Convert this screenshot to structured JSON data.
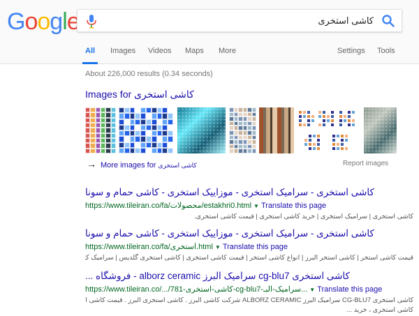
{
  "logo": {
    "text": "Google",
    "letters": [
      "G",
      "o",
      "o",
      "g",
      "l",
      "e"
    ],
    "colors": [
      "#4285F4",
      "#EA4335",
      "#FBBC05",
      "#4285F4",
      "#34A853",
      "#EA4335"
    ]
  },
  "search": {
    "query": "کاشی استخری",
    "mic_icon": "mic-icon",
    "search_icon": "magnifier-icon"
  },
  "tabs": {
    "all": "All",
    "images": "Images",
    "videos": "Videos",
    "maps": "Maps",
    "more": "More",
    "settings": "Settings",
    "tools": "Tools"
  },
  "stats": "About 226,000 results (0.34 seconds)",
  "images_block": {
    "title_prefix": "Images for ",
    "title_query": "کاشی استخری",
    "more_prefix": "More images for ",
    "more_query": "کاشی استخری",
    "report": "Report images"
  },
  "results": [
    {
      "title": "کاشی استخری - سرامیک استخری - موزاییک استخری - کاشی حمام و سونا",
      "url": "https://www.tileiran.co/fa/محصولات/estakhri0.html",
      "translate": "Translate this page",
      "snippet": "کاشی استخری | سرامیک استخری | خرید کاشی استخری | قیمت کاشی استخری."
    },
    {
      "title": "کاشی استخری - سرامیک استخری - موزاییک استخری - کاشی حمام و سونا",
      "url": "https://www.tileiran.co/fa/استخری.html",
      "translate": "Translate this page",
      "snippet": "قیمت کاشی استخر | کاشی استخر البرز | انواع کاشی استخر | قیمت کاشی استخری | کاشی استخری گلدیس | سرامیک کاشی استخری"
    },
    {
      "title": "کاشی استخری cg-blu7 سرامیک البرز alborz ceramic - فروشگاه ...",
      "url": "https://www.tileiran.co/.../781-کاشی-استخری-cg-blu7-سرامیک-البـ...",
      "translate": "Translate this page",
      "snippet": "کاشی استخری CG-BLU7 سرامیک البرز ALBORZ CERAMIC شرکت کاشی البرز . کاشی استخری البرز . قیمت کاشی استخری البرز . قیمت",
      "snippet2": "کاشی استخری ، خرید ..."
    }
  ],
  "thumbnails": [
    {
      "name": "thumb-colorful-mosaic",
      "colors": [
        "#d9534f",
        "#5bc0de",
        "#f0ad4e",
        "#5cb85c",
        "#9b59b6",
        "#2c3e50"
      ]
    },
    {
      "name": "thumb-blue-mosaic",
      "colors": [
        "#1e3a8a",
        "#2563eb",
        "#93c5fd",
        "#ffffff",
        "#1d4ed8",
        "#60a5fa"
      ]
    },
    {
      "name": "thumb-pool-water",
      "colors": [
        "#0e7490",
        "#67e8f9",
        "#155e75",
        "#a5f3fc"
      ]
    },
    {
      "name": "thumb-pastel-mosaic",
      "colors": [
        "#7c93b5",
        "#c9b29b",
        "#9fb9c9",
        "#e2d3c3",
        "#5f7a99"
      ]
    },
    {
      "name": "thumb-tile-store",
      "colors": [
        "#a0522d",
        "#7b6a58",
        "#c8a882",
        "#4b3b2f",
        "#e6c9a8"
      ]
    },
    {
      "name": "thumb-small-tiles",
      "colors": [
        "#e08a3c",
        "#f4b183",
        "#3b5ba5",
        "#ffffff",
        "#2f2f8f",
        "#66a3d2"
      ]
    },
    {
      "name": "thumb-pool-tiles",
      "colors": [
        "#8c9a8f",
        "#c1c7bd",
        "#4a6c6f",
        "#d9ded5"
      ]
    }
  ]
}
